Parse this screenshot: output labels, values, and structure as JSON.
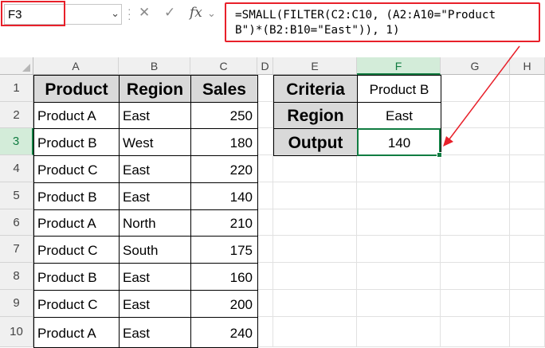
{
  "name_box": {
    "value": "F3"
  },
  "formula_bar": {
    "line1": "=SMALL(FILTER(C2:C10, (A2:A10=\"Product",
    "line2": "B\")*(B2:B10=\"East\")), 1)",
    "cancel_icon": "close-icon",
    "enter_icon": "check-icon",
    "fx_label": "fx"
  },
  "columns": [
    "A",
    "B",
    "C",
    "D",
    "E",
    "F",
    "G",
    "H"
  ],
  "rows": [
    "1",
    "2",
    "3",
    "4",
    "5",
    "6",
    "7",
    "8",
    "9",
    "10"
  ],
  "table": {
    "headers": [
      "Product",
      "Region",
      "Sales"
    ],
    "rows": [
      [
        "Product A",
        "East",
        "250"
      ],
      [
        "Product B",
        "West",
        "180"
      ],
      [
        "Product C",
        "East",
        "220"
      ],
      [
        "Product B",
        "East",
        "140"
      ],
      [
        "Product A",
        "North",
        "210"
      ],
      [
        "Product C",
        "South",
        "175"
      ],
      [
        "Product B",
        "East",
        "160"
      ],
      [
        "Product C",
        "East",
        "200"
      ],
      [
        "Product A",
        "East",
        "240"
      ]
    ]
  },
  "criteria": {
    "rows": [
      [
        "Criteria",
        "Product B"
      ],
      [
        "Region",
        "East"
      ],
      [
        "Output",
        "140"
      ]
    ]
  },
  "colors": {
    "highlight_red": "#e8202a",
    "excel_green": "#107c41",
    "header_gray": "#d9d9d9"
  }
}
